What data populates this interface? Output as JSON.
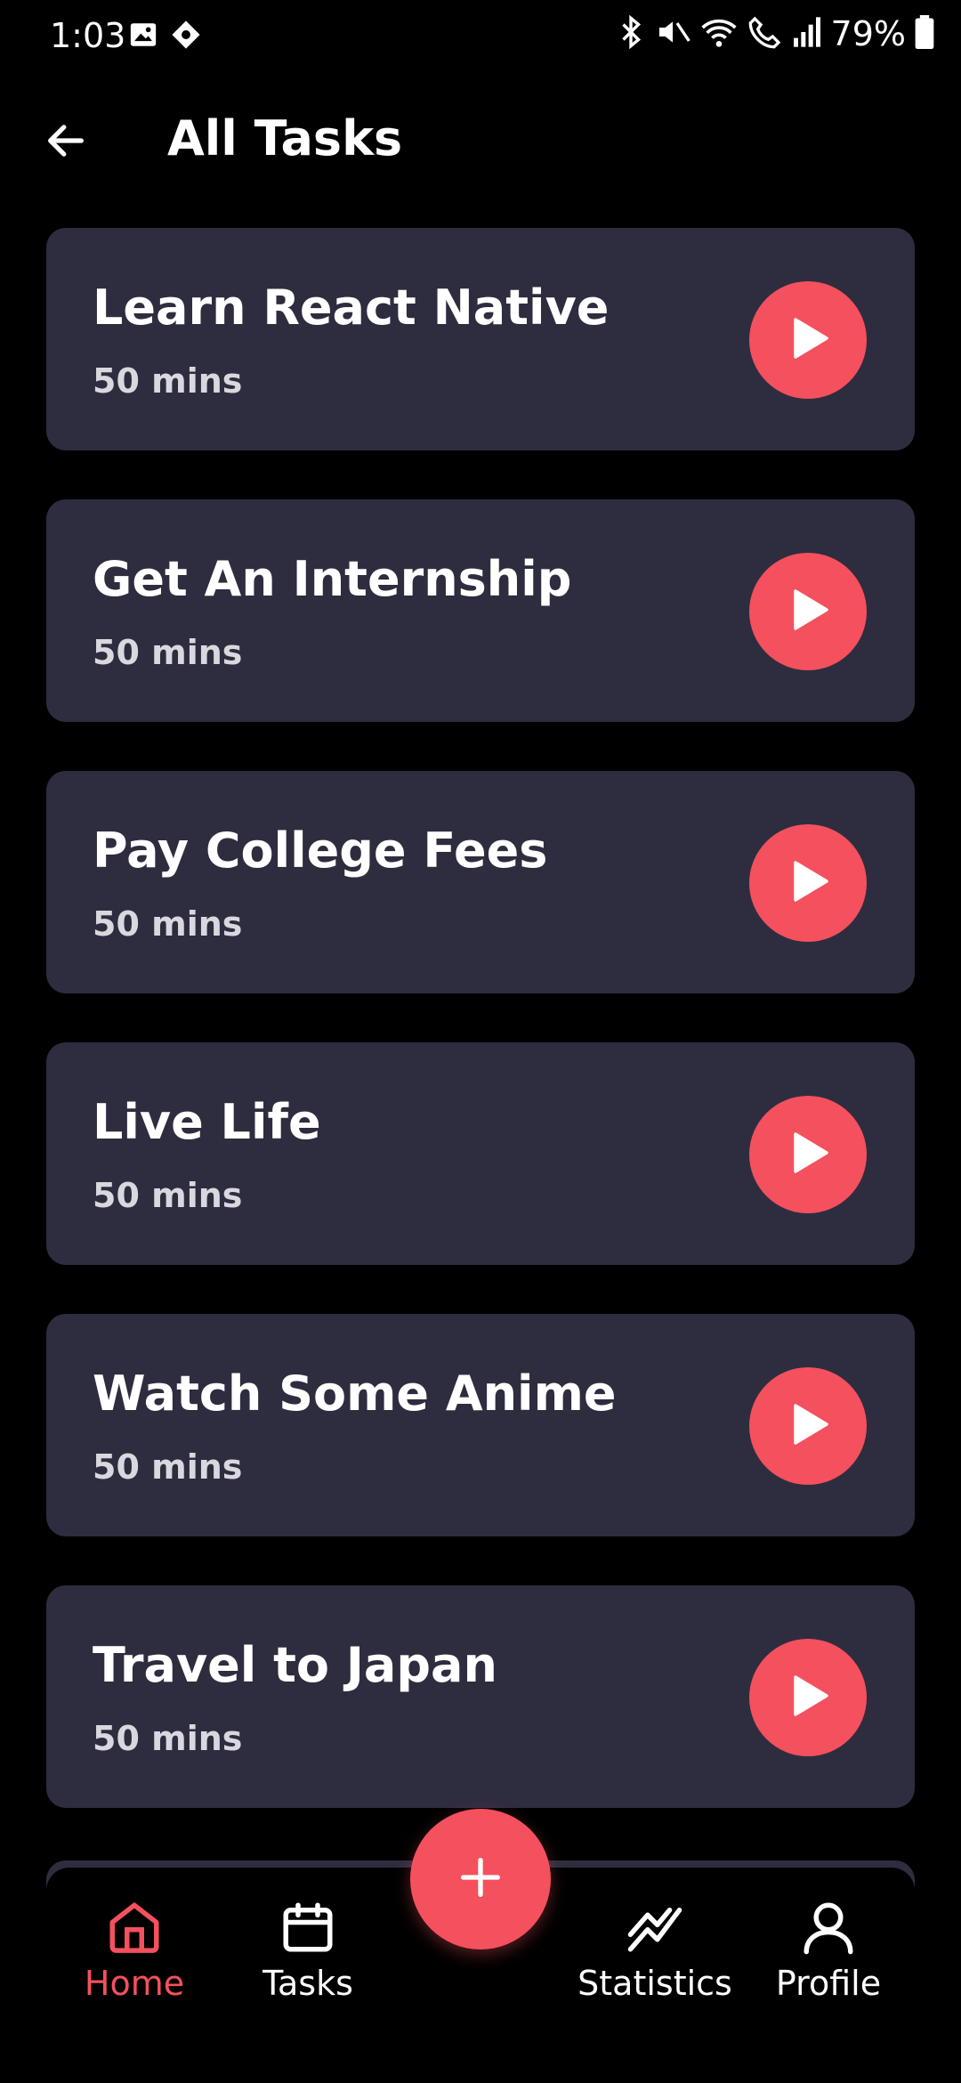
{
  "status_bar": {
    "time": "1:03",
    "battery": "79%",
    "icons": [
      "image-icon",
      "navigation-icon",
      "bluetooth-icon",
      "mute-icon",
      "wifi-icon",
      "call-icon",
      "signal-icon",
      "battery-icon"
    ]
  },
  "header": {
    "title": "All Tasks",
    "back_icon": "arrow-left-icon"
  },
  "tasks": [
    {
      "title": "Learn React Native",
      "duration": "50 mins"
    },
    {
      "title": "Get An Internship",
      "duration": "50 mins"
    },
    {
      "title": "Pay College Fees",
      "duration": "50 mins"
    },
    {
      "title": "Live Life",
      "duration": "50 mins"
    },
    {
      "title": "Watch Some Anime",
      "duration": "50 mins"
    },
    {
      "title": "Travel to Japan",
      "duration": "50 mins"
    }
  ],
  "fab": {
    "icon": "plus-icon"
  },
  "bottom_nav": {
    "items": [
      {
        "label": "Home",
        "icon": "home-icon",
        "active": true
      },
      {
        "label": "Tasks",
        "icon": "calendar-icon",
        "active": false
      },
      {
        "label": "Statistics",
        "icon": "chart-line-icon",
        "active": false
      },
      {
        "label": "Profile",
        "icon": "user-icon",
        "active": false
      }
    ]
  },
  "colors": {
    "background": "#000000",
    "card": "#2e2d3f",
    "accent": "#f5505d",
    "text": "#ffffff",
    "subtext": "#d8d8de"
  }
}
